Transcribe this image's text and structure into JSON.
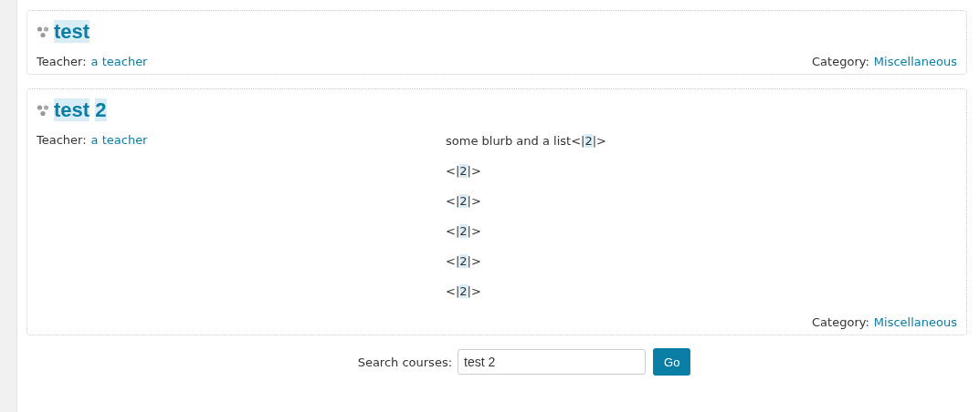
{
  "courses": [
    {
      "title": [
        {
          "text": "test",
          "highlight": true
        }
      ],
      "teacher_label": "Teacher:",
      "teacher": "a teacher",
      "category_label": "Category:",
      "category": "Miscellaneous"
    },
    {
      "title": [
        {
          "text": "test",
          "highlight": true
        },
        {
          "text": "2",
          "highlight": true
        }
      ],
      "teacher_label": "Teacher:",
      "teacher": "a teacher",
      "summary": [
        [
          {
            "text": "some blurb and a list<|",
            "highlight": false
          },
          {
            "text": "2",
            "highlight": true
          },
          {
            "text": "|>",
            "highlight": false
          }
        ],
        [
          {
            "text": "<|",
            "highlight": false
          },
          {
            "text": "2",
            "highlight": true
          },
          {
            "text": "|>",
            "highlight": false
          }
        ],
        [
          {
            "text": "<|",
            "highlight": false
          },
          {
            "text": "2",
            "highlight": true
          },
          {
            "text": "|>",
            "highlight": false
          }
        ],
        [
          {
            "text": "<|",
            "highlight": false
          },
          {
            "text": "2",
            "highlight": true
          },
          {
            "text": "|>",
            "highlight": false
          }
        ],
        [
          {
            "text": "<|",
            "highlight": false
          },
          {
            "text": "2",
            "highlight": true
          },
          {
            "text": "|>",
            "highlight": false
          }
        ],
        [
          {
            "text": "<|",
            "highlight": false
          },
          {
            "text": "2",
            "highlight": true
          },
          {
            "text": "|>",
            "highlight": false
          }
        ]
      ],
      "category_label": "Category:",
      "category": "Miscellaneous"
    }
  ],
  "search": {
    "label": "Search courses:",
    "value": "test 2",
    "button": "Go"
  }
}
